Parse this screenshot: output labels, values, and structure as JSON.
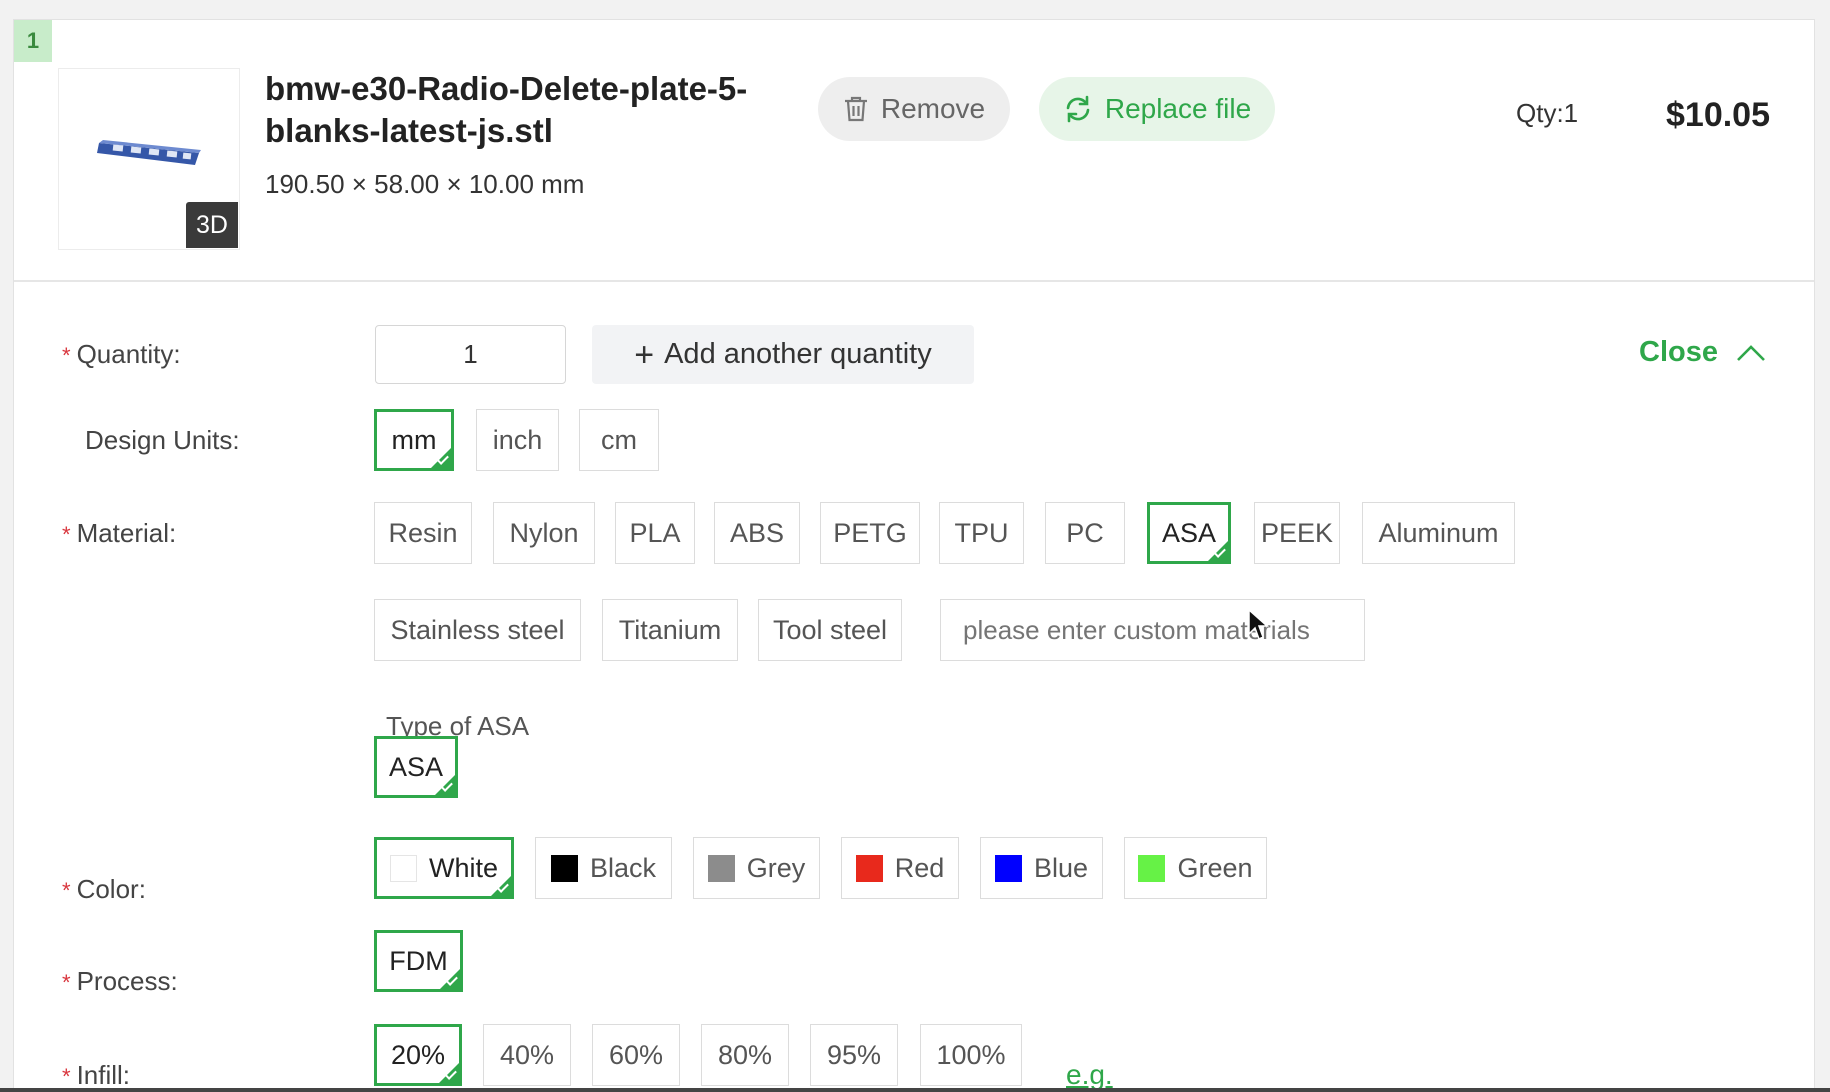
{
  "item": {
    "index": "1",
    "thumbnail_badge": "3D",
    "file_name": "bmw-e30-Radio-Delete-plate-5-blanks-latest-js.stl",
    "dimensions": "190.50 × 58.00 × 10.00 mm",
    "remove_label": "Remove",
    "replace_label": "Replace file",
    "qty_summary": "Qty:1",
    "price": "$10.05"
  },
  "config": {
    "required_mark": "*",
    "close_label": "Close",
    "quantity": {
      "label": "Quantity:",
      "value": "1",
      "add_label": "Add another quantity"
    },
    "design_units": {
      "label": "Design Units:",
      "options": [
        "mm",
        "inch",
        "cm"
      ],
      "selected": "mm"
    },
    "material": {
      "label": "Material:",
      "options": [
        "Resin",
        "Nylon",
        "PLA",
        "ABS",
        "PETG",
        "TPU",
        "PC",
        "ASA",
        "PEEK",
        "Aluminum",
        "Stainless steel",
        "Titanium",
        "Tool steel"
      ],
      "selected": "ASA",
      "custom_placeholder": "please enter custom materials"
    },
    "material_type": {
      "label": "Type of ASA",
      "options": [
        "ASA"
      ],
      "selected": "ASA"
    },
    "color": {
      "label": "Color:",
      "options": [
        {
          "name": "White",
          "swatch": "#ffffff"
        },
        {
          "name": "Black",
          "swatch": "#000000"
        },
        {
          "name": "Grey",
          "swatch": "#8c8c8c"
        },
        {
          "name": "Red",
          "swatch": "#e8291c"
        },
        {
          "name": "Blue",
          "swatch": "#0000ff"
        },
        {
          "name": "Green",
          "swatch": "#66f246"
        }
      ],
      "selected": "White"
    },
    "process": {
      "label": "Process:",
      "options": [
        "FDM"
      ],
      "selected": "FDM"
    },
    "infill": {
      "label": "Infill:",
      "options": [
        "20%",
        "40%",
        "60%",
        "80%",
        "95%",
        "100%"
      ],
      "selected": "20%",
      "example_link": "e.g."
    }
  },
  "colors": {
    "accent": "#2fa74a",
    "required": "#d9363e"
  }
}
